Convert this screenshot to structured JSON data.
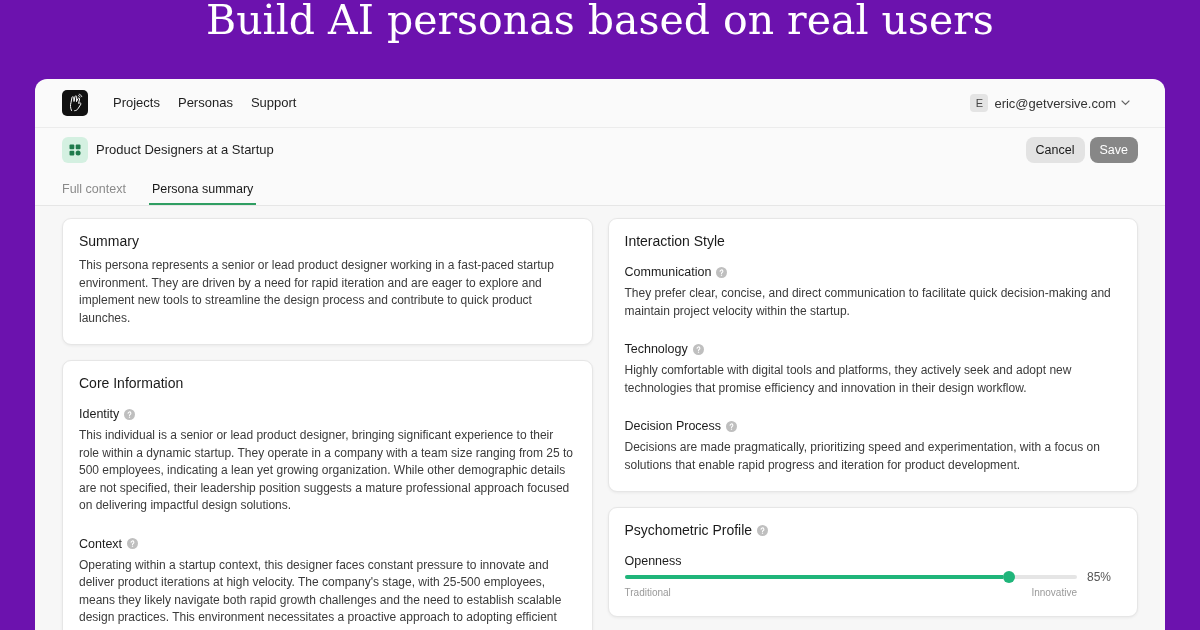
{
  "headline": "Build AI personas based on real users",
  "nav": {
    "items": [
      {
        "label": "Projects"
      },
      {
        "label": "Personas"
      },
      {
        "label": "Support"
      }
    ],
    "account": {
      "initial": "E",
      "email": "eric@getversive.com"
    }
  },
  "header": {
    "title": "Product Designers at a Startup",
    "buttons": [
      {
        "label": "Cancel",
        "kind": "secondary"
      },
      {
        "label": "Save",
        "kind": "primary"
      }
    ]
  },
  "tabs": [
    {
      "label": "Full context",
      "selected": false
    },
    {
      "label": "Persona summary",
      "selected": true
    }
  ],
  "columns": [
    {
      "cards": [
        {
          "kind": "text",
          "title": "Summary",
          "help": false,
          "text": "This persona represents a senior or lead product designer working in a fast-paced startup environment. They are driven by a need for rapid iteration and are eager to explore and implement new tools to streamline the design process and contribute to quick product launches."
        },
        {
          "kind": "sections",
          "title": "Core Information",
          "help": false,
          "sections": [
            {
              "label": "Identity",
              "help": true,
              "text": "This individual is a senior or lead product designer, bringing significant experience to their role within a dynamic startup. They operate in a company with a team size ranging from 25 to 500 employees, indicating a lean yet growing organization. While other demographic details are not specified, their leadership position suggests a mature professional approach focused on delivering impactful design solutions."
            },
            {
              "label": "Context",
              "help": true,
              "text": "Operating within a startup context, this designer faces constant pressure to innovate and deliver product iterations at high velocity. The company's stage, with 25-500 employees, means they likely navigate both rapid growth challenges and the need to establish scalable design practices. This environment necessitates a proactive approach to adopting efficient"
            }
          ]
        }
      ]
    },
    {
      "cards": [
        {
          "kind": "sections",
          "title": "Interaction Style",
          "help": false,
          "sections": [
            {
              "label": "Communication",
              "help": true,
              "text": "They prefer clear, concise, and direct communication to facilitate quick decision-making and maintain project velocity within the startup."
            },
            {
              "label": "Technology",
              "help": true,
              "text": "Highly comfortable with digital tools and platforms, they actively seek and adopt new technologies that promise efficiency and innovation in their design workflow."
            },
            {
              "label": "Decision Process",
              "help": true,
              "text": "Decisions are made pragmatically, prioritizing speed and experimentation, with a focus on solutions that enable rapid progress and iteration for product development."
            }
          ]
        },
        {
          "kind": "traits",
          "title": "Psychometric Profile",
          "help": true,
          "traits": [
            {
              "name": "Openness",
              "level": 0.85,
              "reading": "85%",
              "low_label": "Traditional",
              "high_label": "Innovative"
            }
          ]
        }
      ]
    }
  ]
}
